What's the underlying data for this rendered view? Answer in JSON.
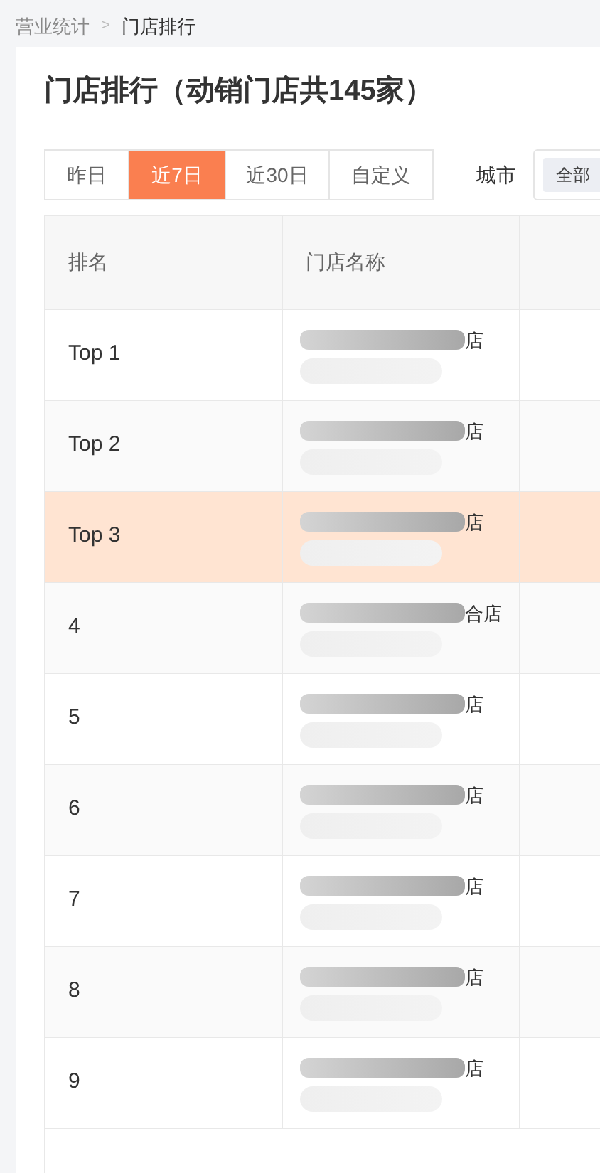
{
  "breadcrumb": [
    {
      "label": "营业统计",
      "current": false
    },
    {
      "label": "门店排行",
      "current": true
    }
  ],
  "breadcrumb_separator": ">",
  "title": "门店排行（动销门店共145家）",
  "period_tabs": [
    {
      "label": "昨日",
      "selected": false
    },
    {
      "label": "近7日",
      "selected": true
    },
    {
      "label": "近30日",
      "selected": false
    },
    {
      "label": "自定义",
      "selected": false
    }
  ],
  "city_filter": {
    "label": "城市",
    "value": "全部"
  },
  "table": {
    "columns": [
      "排名",
      "门店名称"
    ],
    "rows": [
      {
        "rank": "Top 1",
        "store_name": "店",
        "selected": false
      },
      {
        "rank": "Top 2",
        "store_name": "店",
        "selected": false
      },
      {
        "rank": "Top 3",
        "store_name": "店",
        "selected": true
      },
      {
        "rank": "4",
        "store_name": "合店",
        "selected": false
      },
      {
        "rank": "5",
        "store_name": "店",
        "selected": false
      },
      {
        "rank": "6",
        "store_name": "店",
        "selected": false
      },
      {
        "rank": "7",
        "store_name": "店",
        "selected": false
      },
      {
        "rank": "8",
        "store_name": "店",
        "selected": false
      },
      {
        "rank": "9",
        "store_name": "店",
        "selected": false
      }
    ]
  }
}
